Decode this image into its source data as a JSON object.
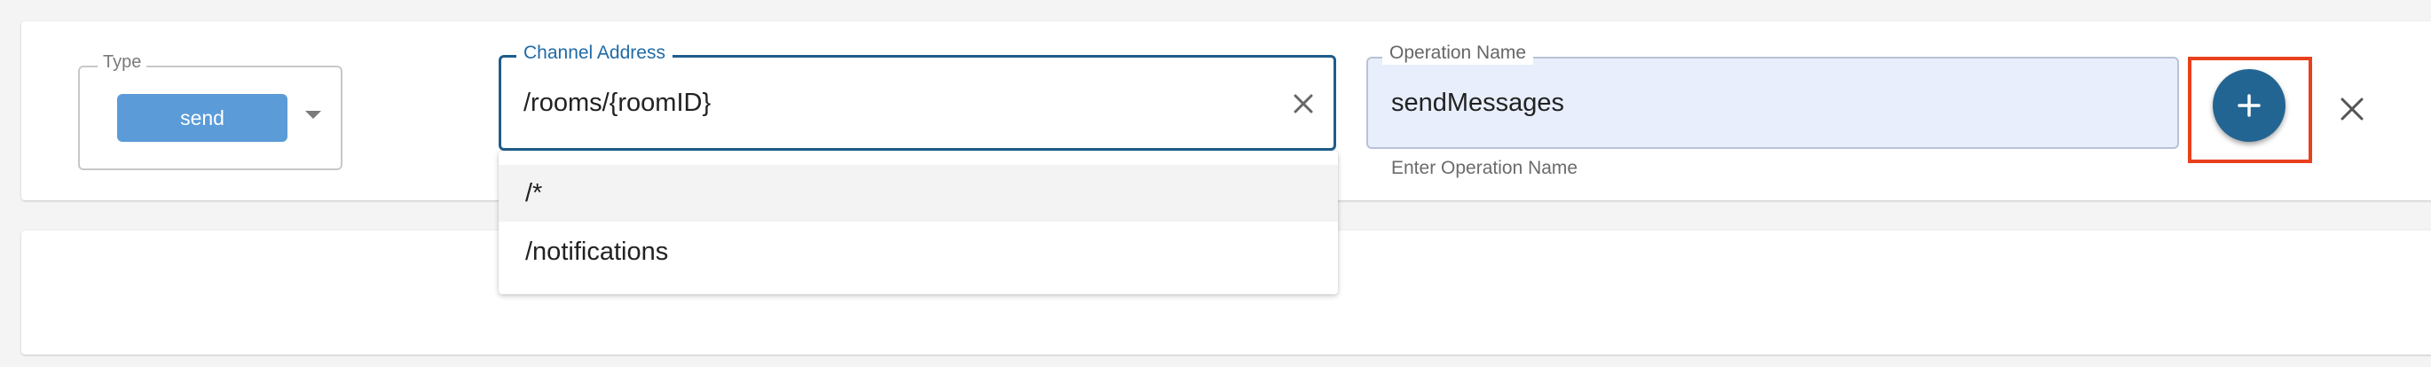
{
  "type_field": {
    "legend": "Type",
    "selected": "send",
    "caret_icon": "caret-down-icon"
  },
  "channel_field": {
    "legend": "Channel Address",
    "value": "/rooms/{roomID}",
    "clear_icon": "close-icon",
    "accent_color": "#1f5d8c",
    "options": [
      "/*",
      "/notifications"
    ]
  },
  "operation_field": {
    "legend": "Operation Name",
    "value": "sendMessages",
    "helper": "Enter Operation Name",
    "background_color": "#e8eefc"
  },
  "actions": {
    "add_icon": "plus-icon",
    "add_color": "#236592",
    "highlight_color": "#e8401c",
    "remove_icon": "close-icon"
  }
}
